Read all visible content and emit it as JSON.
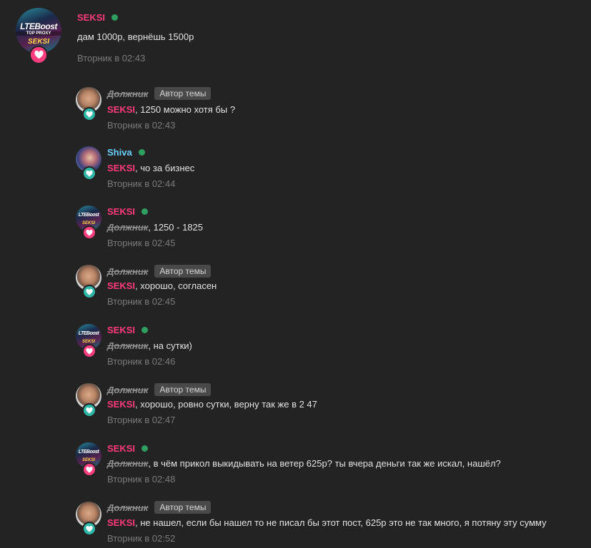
{
  "colors": {
    "background": "#232323",
    "seksi": "#ff3a7c",
    "shiva": "#69d2ff",
    "online": "#2f9e61",
    "timestamp": "#7a7a7a",
    "badge_pink": "#ff3d7f",
    "badge_teal": "#2fb8a8"
  },
  "avatar_text": {
    "logo": "LTEBoost",
    "sub": "TOP PROXY",
    "name": "SEKSI"
  },
  "posts": [
    {
      "author": "SEKSI",
      "online": true,
      "mention": "",
      "text": "дам 1000р, вернёшь 1500р",
      "time": "Вторник в 02:43"
    },
    {
      "author": "Должник",
      "tag": "Автор темы",
      "mention": "SEKSI",
      "text": ", 1250 можно хотя бы ?",
      "time": "Вторник в 02:43"
    },
    {
      "author": "Shiva",
      "online": true,
      "mention": "SEKSI",
      "text": ", чо за бизнес",
      "time": "Вторник в 02:44"
    },
    {
      "author": "SEKSI",
      "online": true,
      "mention": "Должник",
      "text": ", 1250 - 1825",
      "time": "Вторник в 02:45"
    },
    {
      "author": "Должник",
      "tag": "Автор темы",
      "mention": "SEKSI",
      "text": ", хорошо, согласен",
      "time": "Вторник в 02:45"
    },
    {
      "author": "SEKSI",
      "online": true,
      "mention": "Должник",
      "text": ", на сутки)",
      "time": "Вторник в 02:46"
    },
    {
      "author": "Должник",
      "tag": "Автор темы",
      "mention": "SEKSI",
      "text": ", хорошо, ровно сутки, верну так же в 2 47",
      "time": "Вторник в 02:47"
    },
    {
      "author": "SEKSI",
      "online": true,
      "mention": "Должник",
      "text": ", в чём прикол выкидывать на ветер 625р? ты вчера деньги так же искал, нашёл?",
      "time": "Вторник в 02:48"
    },
    {
      "author": "Должник",
      "tag": "Автор темы",
      "mention": "SEKSI",
      "text": ", не нашел, если бы нашел то не писал бы этот пост, 625р это не так много, я потяну эту сумму",
      "time": "Вторник в 02:52"
    }
  ]
}
